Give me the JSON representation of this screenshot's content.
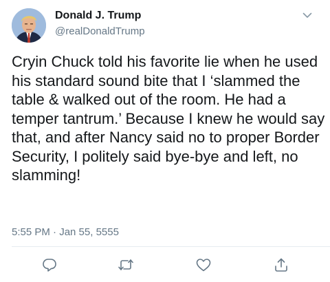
{
  "user": {
    "name": "Donald J. Trump",
    "handle": "@realDonaldTrump"
  },
  "tweet": {
    "text": "Cryin Chuck told his favorite lie when he used his standard sound bite that I ‘slammed the table & walked out of the room. He had a temper tantrum.’ Because I knew he would say that, and after Nancy said no to proper Border Security, I politely said bye-bye and left, no slamming!",
    "timestamp": "5:55 PM · Jan 55, 5555"
  },
  "icons": {
    "menu": "chevron-down-icon",
    "reply": "reply-icon",
    "retweet": "retweet-icon",
    "like": "like-icon",
    "share": "share-icon"
  },
  "colors": {
    "text": "#14171a",
    "secondary": "#657786",
    "icon": "#657786",
    "divider": "#e6ecf0"
  }
}
